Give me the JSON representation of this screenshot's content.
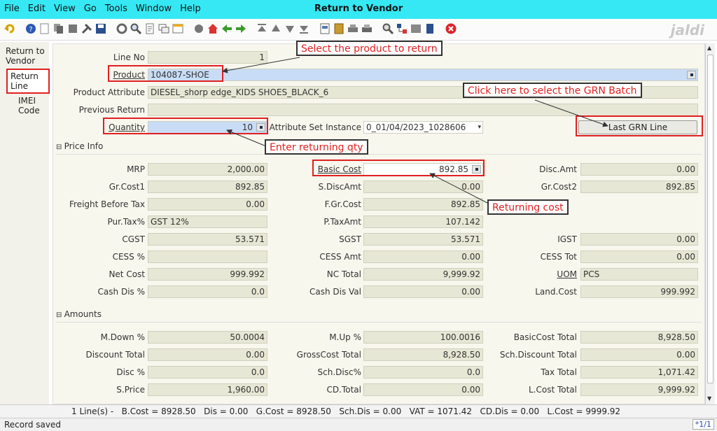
{
  "window": {
    "title": "Return to Vendor"
  },
  "menu": [
    {
      "label": "File"
    },
    {
      "label": "Edit"
    },
    {
      "label": "View"
    },
    {
      "label": "Go"
    },
    {
      "label": "Tools"
    },
    {
      "label": "Window"
    },
    {
      "label": "Help"
    }
  ],
  "logo": "jaldi",
  "sidetabs": [
    {
      "label": "Return to Vendor"
    },
    {
      "label": "Return Line"
    },
    {
      "label": "IMEI Code"
    }
  ],
  "fields": {
    "line_no": {
      "label": "Line No",
      "value": "1"
    },
    "product": {
      "label": "Product",
      "value": "104087-SHOE"
    },
    "product_attr": {
      "label": "Product Attribute",
      "value": "DIESEL_shorp edge_KIDS SHOES_BLACK_6"
    },
    "previous_return": {
      "label": "Previous Return",
      "value": ""
    },
    "quantity": {
      "label": "Quantity",
      "value": "10"
    },
    "attr_set_instance": {
      "label": "Attribute Set Instance",
      "value": "0_01/04/2023_1028606"
    },
    "last_grn_button": "Last GRN Line"
  },
  "sections": {
    "price_info": "Price Info",
    "amounts": "Amounts"
  },
  "price": {
    "mrp": {
      "label": "MRP",
      "value": "2,000.00"
    },
    "basic_cost": {
      "label": "Basic Cost",
      "value": "892.85"
    },
    "disc_amt": {
      "label": "Disc.Amt",
      "value": "0.00"
    },
    "gr_cost1": {
      "label": "Gr.Cost1",
      "value": "892.85"
    },
    "s_disc_amt": {
      "label": "S.DiscAmt",
      "value": "0.00"
    },
    "gr_cost2": {
      "label": "Gr.Cost2",
      "value": "892.85"
    },
    "freight": {
      "label": "Freight Before Tax",
      "value": "0.00"
    },
    "f_gr_cost": {
      "label": "F.Gr.Cost",
      "value": "892.85"
    },
    "pur_tax": {
      "label": "Pur.Tax%",
      "value": "GST 12%"
    },
    "p_tax_amt": {
      "label": "P.TaxAmt",
      "value": "107.142"
    },
    "cgst": {
      "label": "CGST",
      "value": "53.571"
    },
    "sgst": {
      "label": "SGST",
      "value": "53.571"
    },
    "igst": {
      "label": "IGST",
      "value": "0.00"
    },
    "cess_pct": {
      "label": "CESS %",
      "value": ""
    },
    "cess_amt": {
      "label": "CESS Amt",
      "value": "0.00"
    },
    "cess_tot": {
      "label": "CESS Tot",
      "value": "0.00"
    },
    "net_cost": {
      "label": "Net Cost",
      "value": "999.992"
    },
    "nc_total": {
      "label": "NC Total",
      "value": "9,999.92"
    },
    "uom": {
      "label": "UOM",
      "value": "PCS"
    },
    "cash_dis_pct": {
      "label": "Cash Dis %",
      "value": "0.0"
    },
    "cash_dis_val": {
      "label": "Cash Dis Val",
      "value": "0.00"
    },
    "land_cost": {
      "label": "Land.Cost",
      "value": "999.992"
    }
  },
  "amounts": {
    "m_down": {
      "label": "M.Down %",
      "value": "50.0004"
    },
    "m_up": {
      "label": "M.Up %",
      "value": "100.0016"
    },
    "basic_cost_total": {
      "label": "BasicCost Total",
      "value": "8,928.50"
    },
    "discount_total": {
      "label": "Discount Total",
      "value": "0.00"
    },
    "gross_cost_total": {
      "label": "GrossCost Total",
      "value": "8,928.50"
    },
    "sch_discount_total": {
      "label": "Sch.Discount Total",
      "value": "0.00"
    },
    "disc_pct": {
      "label": "Disc %",
      "value": "0.0"
    },
    "sch_disc_pct": {
      "label": "Sch.Disc%",
      "value": "0.0"
    },
    "tax_total": {
      "label": "Tax Total",
      "value": "1,071.42"
    },
    "s_price": {
      "label": "S.Price",
      "value": "1,960.00"
    },
    "cd_total": {
      "label": "CD.Total",
      "value": "0.00"
    },
    "l_cost_total": {
      "label": "L.Cost Total",
      "value": "9,999.92"
    }
  },
  "annotations": {
    "select_product": "Select the product to return",
    "grn_batch": "Click here to select the GRN Batch",
    "enter_qty": "Enter returning qty",
    "returning_cost": "Returning cost"
  },
  "status": {
    "summary": "1 Line(s) -   B.Cost = 8928.50   Dis = 0.00   G.Cost = 8928.50   Sch.Dis = 0.00   VAT = 1071.42   CD.Dis = 0.00   L.Cost = 9999.92",
    "message": "Record saved",
    "page": "*1/1"
  },
  "colors": {
    "titlebar": "#35e8f3",
    "annotation_red": "#e02020",
    "field_bg": "#e7e7d5",
    "highlight_blue": "#c8dcf6"
  }
}
